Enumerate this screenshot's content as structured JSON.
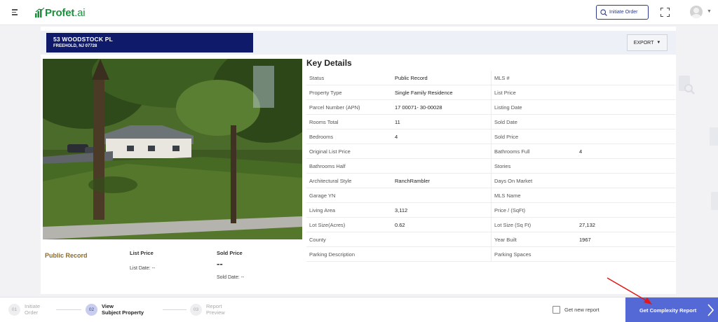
{
  "app": {
    "logo_text": "Profet",
    "logo_suffix": ".ai"
  },
  "header": {
    "initiate_label": "Initiate Order"
  },
  "property": {
    "address_line1": "53 WOODSTOCK PL",
    "address_line2": "FREEHOLD, NJ 07728"
  },
  "export_label": "EXPORT",
  "summary": {
    "source": "Public Record",
    "list_price_label": "List Price",
    "list_date_label": "List Date: --",
    "sold_price_label": "Sold Price",
    "sold_price_value": "--",
    "sold_date_label": "Sold Date: --"
  },
  "key_details": {
    "title": "Key Details",
    "rows": [
      [
        "Status",
        "Public Record",
        "MLS #",
        ""
      ],
      [
        "Property Type",
        "Single Family Residence",
        "List Price",
        ""
      ],
      [
        "Parcel Number (APN)",
        "17 00071- 30-00028",
        "Listing Date",
        ""
      ],
      [
        "Rooms Total",
        "11",
        "Sold Date",
        ""
      ],
      [
        "Bedrooms",
        "4",
        "Sold Price",
        ""
      ],
      [
        "Original List Price",
        "",
        "Bathrooms Full",
        "4"
      ],
      [
        "Bathrooms Half",
        "",
        "Stories",
        ""
      ],
      [
        "Architectural Style",
        "RanchRambler",
        "Days On Market",
        ""
      ],
      [
        "Garage YN",
        "",
        "MLS Name",
        ""
      ],
      [
        "Living Area",
        "3,112",
        "Price / (SqFt)",
        ""
      ],
      [
        "Lot Size(Acres)",
        "0.62",
        "Lot Size (Sq Ft)",
        "27,132"
      ],
      [
        "County",
        "",
        "Year Built",
        "1967"
      ],
      [
        "Parking Description",
        "",
        "Parking Spaces",
        ""
      ]
    ]
  },
  "stepper": {
    "steps": [
      {
        "num": "01",
        "line1": "Initiate",
        "line2": "Order"
      },
      {
        "num": "02",
        "line1": "View",
        "line2": "Subject Property"
      },
      {
        "num": "03",
        "line1": "Report",
        "line2": "Preview"
      }
    ],
    "get_new_report_label": "Get new report",
    "complexity_button_label": "Get Complexity Report"
  },
  "colors": {
    "brand_green": "#1b8f3c",
    "navy": "#101a6b",
    "accent_blue": "#5569d6",
    "public_record_gold": "#8b6b2c"
  }
}
